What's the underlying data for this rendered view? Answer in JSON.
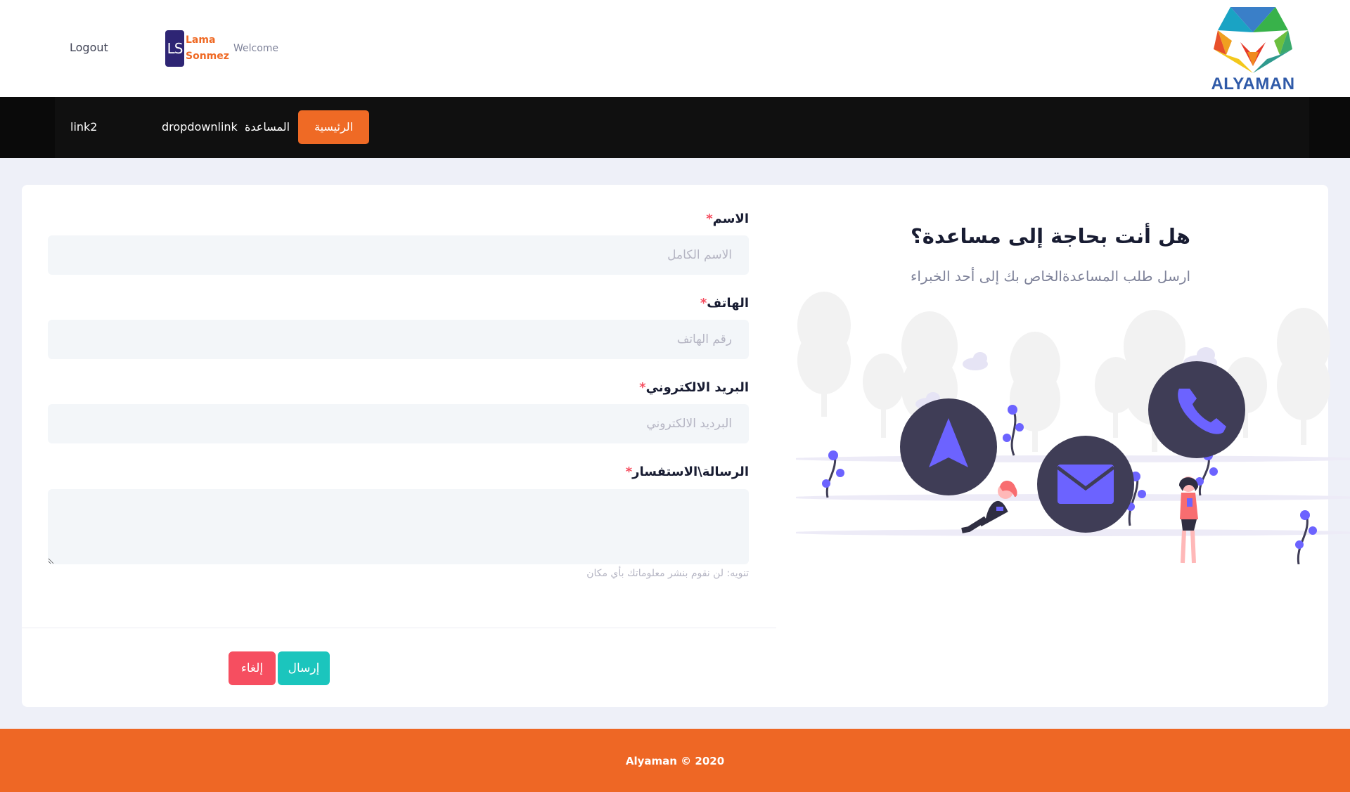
{
  "header": {
    "logout_label": "Logout",
    "avatar_initials": "LS",
    "user_first_name": "Lama",
    "user_last_name": "Sonmez",
    "welcome_label": "Welcome",
    "logo_text": "ALYAMAN"
  },
  "nav": {
    "items": [
      {
        "label": "الرئيسية",
        "active": true
      },
      {
        "label": "المساعدة",
        "active": false
      },
      {
        "label": "dropdownlink",
        "active": false
      },
      {
        "label": "link2",
        "active": false
      }
    ]
  },
  "help": {
    "title": "هل أنت بحاجة إلى مساعدة؟",
    "subtitle": "ارسل طلب المساعدةالخاص بك إلى أحد الخبراء",
    "illustration_icons": [
      "navigation-arrow-icon",
      "envelope-icon",
      "phone-icon"
    ]
  },
  "form": {
    "required_mark": "*",
    "name": {
      "label": "الاسم",
      "placeholder": "الاسم الكامل",
      "value": ""
    },
    "phone": {
      "label": "الهاتف",
      "placeholder": "رقم الهاتف",
      "value": ""
    },
    "email": {
      "label": "البريد الالكتروني",
      "placeholder": "البرديد الالكتروني",
      "value": ""
    },
    "message": {
      "label": "الرسالة\\الاستفسار",
      "placeholder": "",
      "value": ""
    },
    "note": "تنويه: لن نقوم بنشر معلوماتك بأي مكان",
    "send_label": "إرسال",
    "cancel_label": "إلغاء"
  },
  "footer": {
    "text": "Alyaman  © 2020"
  },
  "colors": {
    "brand_orange": "#ef6a25",
    "nav_bg": "#0a0a0a",
    "send_button": "#1bc5bd",
    "cancel_button": "#f64e60",
    "illustration_accent": "#6c63ff",
    "illustration_dark": "#3f3d56"
  }
}
